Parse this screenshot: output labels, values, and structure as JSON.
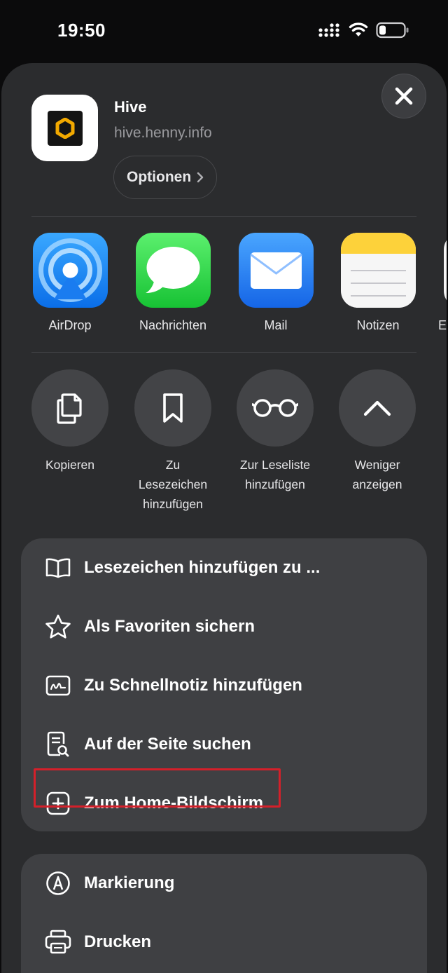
{
  "status_bar": {
    "time": "19:50"
  },
  "header": {
    "app_title": "Hive",
    "app_url": "hive.henny.info",
    "options_label": "Optionen"
  },
  "share_apps": [
    {
      "label": "AirDrop",
      "icon": "airdrop-icon"
    },
    {
      "label": "Nachrichten",
      "icon": "messages-icon"
    },
    {
      "label": "Mail",
      "icon": "mail-icon"
    },
    {
      "label": "Notizen",
      "icon": "notes-icon"
    },
    {
      "label": "E",
      "icon": "partial-app-icon"
    }
  ],
  "actions": [
    {
      "label": "Kopieren",
      "icon": "copy-icon"
    },
    {
      "label": "Zu Lesezeichen hinzufügen",
      "icon": "bookmark-icon"
    },
    {
      "label": "Zur Leseliste hinzufügen",
      "icon": "reading-list-icon"
    },
    {
      "label": "Weniger anzeigen",
      "icon": "chevron-up-icon"
    }
  ],
  "menu_group_1": [
    {
      "label": "Lesezeichen hinzufügen zu ...",
      "icon": "book-icon"
    },
    {
      "label": "Als Favoriten sichern",
      "icon": "star-icon"
    },
    {
      "label": "Zu Schnellnotiz hinzufügen",
      "icon": "quick-note-icon"
    },
    {
      "label": "Auf der Seite suchen",
      "icon": "find-on-page-icon"
    },
    {
      "label": "Zum Home-Bildschirm",
      "icon": "add-square-icon",
      "highlighted": true
    }
  ],
  "menu_group_2": [
    {
      "label": "Markierung",
      "icon": "markup-icon"
    },
    {
      "label": "Drucken",
      "icon": "printer-icon"
    }
  ],
  "colors": {
    "sheet_bg": "#2b2c2e",
    "row_bg": "#3f4043",
    "highlight": "#d4202a"
  }
}
